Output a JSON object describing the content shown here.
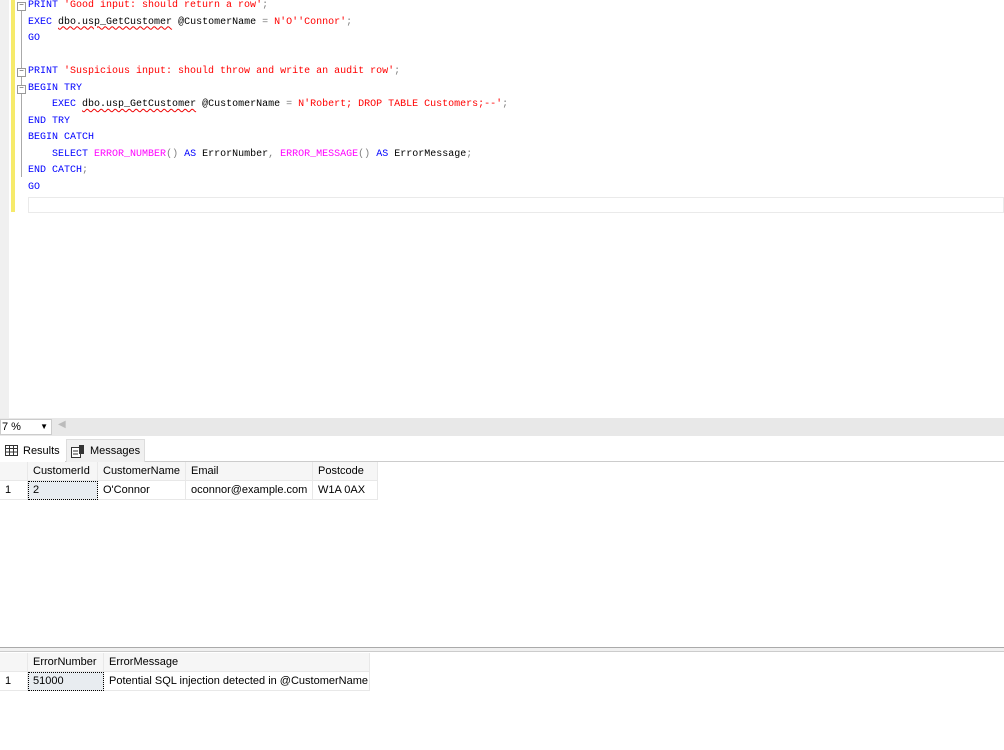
{
  "editor": {
    "lines": [
      [
        {
          "t": "PRINT",
          "c": "kw"
        },
        {
          "t": " ",
          "c": "tx"
        },
        {
          "t": "'Good input: should return a row'",
          "c": "str"
        },
        {
          "t": ";",
          "c": "gr"
        }
      ],
      [
        {
          "t": "EXEC",
          "c": "kw"
        },
        {
          "t": " ",
          "c": "tx"
        },
        {
          "t": "dbo.usp_GetCustomer",
          "c": "tx squig"
        },
        {
          "t": " @CustomerName ",
          "c": "tx"
        },
        {
          "t": "=",
          "c": "gr"
        },
        {
          "t": " ",
          "c": "tx"
        },
        {
          "t": "N'O''Connor'",
          "c": "str"
        },
        {
          "t": ";",
          "c": "gr"
        }
      ],
      [
        {
          "t": "GO",
          "c": "kw"
        }
      ],
      [],
      [
        {
          "t": "PRINT",
          "c": "kw"
        },
        {
          "t": " ",
          "c": "tx"
        },
        {
          "t": "'Suspicious input: should throw and write an audit row'",
          "c": "str"
        },
        {
          "t": ";",
          "c": "gr"
        }
      ],
      [
        {
          "t": "BEGIN",
          "c": "kw"
        },
        {
          "t": " ",
          "c": "tx"
        },
        {
          "t": "TRY",
          "c": "kw"
        }
      ],
      [
        {
          "t": "    ",
          "c": "tx"
        },
        {
          "t": "EXEC",
          "c": "kw"
        },
        {
          "t": " ",
          "c": "tx"
        },
        {
          "t": "dbo.usp_GetCustomer",
          "c": "tx squig"
        },
        {
          "t": " @CustomerName ",
          "c": "tx"
        },
        {
          "t": "=",
          "c": "gr"
        },
        {
          "t": " ",
          "c": "tx"
        },
        {
          "t": "N'Robert; DROP TABLE Customers;--'",
          "c": "str"
        },
        {
          "t": ";",
          "c": "gr"
        }
      ],
      [
        {
          "t": "END",
          "c": "kw"
        },
        {
          "t": " ",
          "c": "tx"
        },
        {
          "t": "TRY",
          "c": "kw"
        }
      ],
      [
        {
          "t": "BEGIN",
          "c": "kw"
        },
        {
          "t": " ",
          "c": "tx"
        },
        {
          "t": "CATCH",
          "c": "kw"
        }
      ],
      [
        {
          "t": "    ",
          "c": "tx"
        },
        {
          "t": "SELECT",
          "c": "kw"
        },
        {
          "t": " ",
          "c": "tx"
        },
        {
          "t": "ERROR_NUMBER",
          "c": "fn"
        },
        {
          "t": "()",
          "c": "gr"
        },
        {
          "t": " ",
          "c": "tx"
        },
        {
          "t": "AS",
          "c": "kw"
        },
        {
          "t": " ErrorNumber",
          "c": "tx"
        },
        {
          "t": ",",
          "c": "gr"
        },
        {
          "t": " ",
          "c": "tx"
        },
        {
          "t": "ERROR_MESSAGE",
          "c": "fn"
        },
        {
          "t": "()",
          "c": "gr"
        },
        {
          "t": " ",
          "c": "tx"
        },
        {
          "t": "AS",
          "c": "kw"
        },
        {
          "t": " ErrorMessage",
          "c": "tx"
        },
        {
          "t": ";",
          "c": "gr"
        }
      ],
      [
        {
          "t": "END",
          "c": "kw"
        },
        {
          "t": " ",
          "c": "tx"
        },
        {
          "t": "CATCH",
          "c": "kw"
        },
        {
          "t": ";",
          "c": "gr"
        }
      ],
      [
        {
          "t": "GO",
          "c": "kw"
        }
      ]
    ]
  },
  "zoom": {
    "value": "7 %"
  },
  "tabs": {
    "results": "Results",
    "messages": "Messages"
  },
  "grid1": {
    "headers": [
      "CustomerId",
      "CustomerName",
      "Email",
      "Postcode"
    ],
    "rows": [
      [
        "1",
        "2",
        "O'Connor",
        "oconnor@example.com",
        "W1A 0AX"
      ]
    ]
  },
  "grid2": {
    "headers": [
      "ErrorNumber",
      "ErrorMessage"
    ],
    "rows": [
      [
        "1",
        "51000",
        "Potential SQL injection detected in @CustomerName"
      ]
    ]
  }
}
